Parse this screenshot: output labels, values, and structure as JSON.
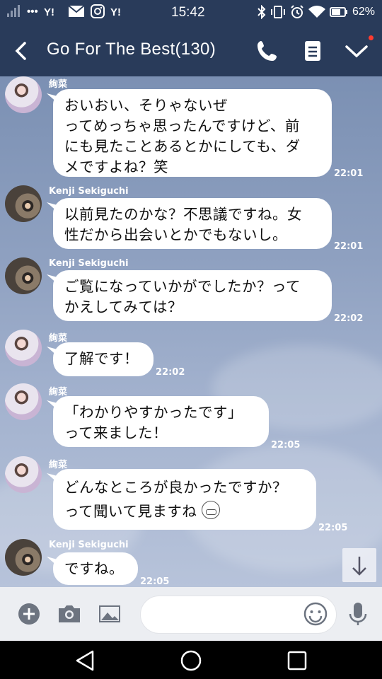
{
  "status_bar": {
    "carrier_dots": "•••",
    "time": "15:42",
    "battery": "62%"
  },
  "header": {
    "title": "Go For The Best(130)"
  },
  "messages": [
    {
      "sender": "絢菜",
      "lines": [
        "おいおい、そりゃないぜ",
        "ってめっちゃ思ったんですけど、前",
        "にも見たことあるとかにしても、ダ",
        "メですよね？笑"
      ],
      "time": "22:01"
    },
    {
      "sender": "Kenji Sekiguchi",
      "lines": [
        "以前見たのかな？不思議ですね。女",
        "性だから出会いとかでもないし。"
      ],
      "time": "22:01"
    },
    {
      "sender": "Kenji Sekiguchi",
      "lines": [
        "ご覧になっていかがでしたか？って",
        "かえしてみては？"
      ],
      "time": "22:02"
    },
    {
      "sender": "絢菜",
      "lines": [
        "了解です！"
      ],
      "time": "22:02"
    },
    {
      "sender": "絢菜",
      "lines": [
        "「わかりやすかったです」",
        "って来ました！"
      ],
      "time": "22:05"
    },
    {
      "sender": "絢菜",
      "lines": [
        "どんなところが良かったですか？",
        "って聞いて見ますね"
      ],
      "time": "22:05"
    },
    {
      "sender": "Kenji Sekiguchi",
      "lines": [
        "ですね。"
      ],
      "time": "22:05"
    }
  ]
}
